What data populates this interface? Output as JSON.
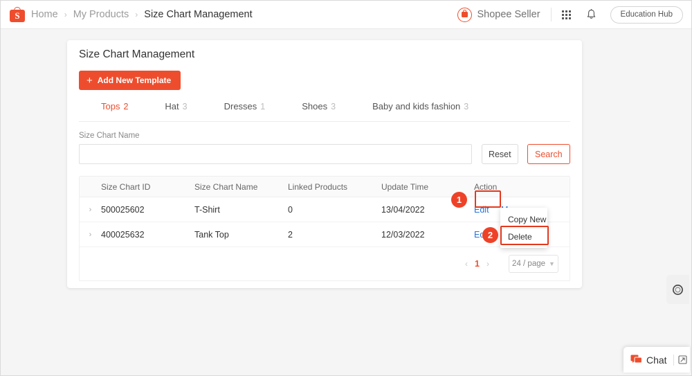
{
  "header": {
    "logo_icon": "shopee-bag-icon",
    "breadcrumb": [
      {
        "label": "Home",
        "current": false
      },
      {
        "label": "My Products",
        "current": false
      },
      {
        "label": "Size Chart Management",
        "current": true
      }
    ],
    "separator": "›",
    "seller_label": "Shopee Seller",
    "apps_icon": "apps-grid-icon",
    "bell_icon": "bell-icon",
    "education_hub_label": "Education Hub"
  },
  "card": {
    "title": "Size Chart Management",
    "add_button": {
      "label": "Add New Template",
      "icon": "plus-icon"
    },
    "tabs": [
      {
        "label": "Tops",
        "count": "2",
        "active": true
      },
      {
        "label": "Hat",
        "count": "3",
        "active": false
      },
      {
        "label": "Dresses",
        "count": "1",
        "active": false
      },
      {
        "label": "Shoes",
        "count": "3",
        "active": false
      },
      {
        "label": "Baby and kids fashion",
        "count": "3",
        "active": false
      }
    ],
    "search": {
      "label": "Size Chart Name",
      "value": "",
      "placeholder": "",
      "reset_label": "Reset",
      "search_label": "Search"
    },
    "table": {
      "columns": [
        "Size Chart ID",
        "Size Chart Name",
        "Linked Products",
        "Update Time",
        "Action"
      ],
      "expand_icon": "chevron-right-icon",
      "rows": [
        {
          "id": "500025602",
          "name": "T-Shirt",
          "linked_products": "0",
          "update_time": "13/04/2022",
          "edit_label": "Edit",
          "more_label": "More"
        },
        {
          "id": "400025632",
          "name": "Tank Top",
          "linked_products": "2",
          "update_time": "12/03/2022",
          "edit_label": "Edit",
          "more_label": ""
        }
      ]
    },
    "dropdown": {
      "items": [
        "Copy New",
        "Delete"
      ]
    },
    "pagination": {
      "prev_icon": "chevron-left-icon",
      "page": "1",
      "next_icon": "chevron-right-icon",
      "page_size": "24 / page",
      "page_size_icon": "chevron-down-icon"
    }
  },
  "annotations": [
    {
      "number": "1",
      "target": "edit-link-row-1"
    },
    {
      "number": "2",
      "target": "delete-menu-item"
    }
  ],
  "side_tab": {
    "icon": "ring-icon"
  },
  "chat": {
    "label": "Chat",
    "icon": "chat-bubble-icon",
    "expand_icon": "popout-icon"
  },
  "colors": {
    "accent": "#ee4d2d",
    "annotation": "#e4391d",
    "link": "#2673dd",
    "page_bg": "#f5f5f5"
  }
}
